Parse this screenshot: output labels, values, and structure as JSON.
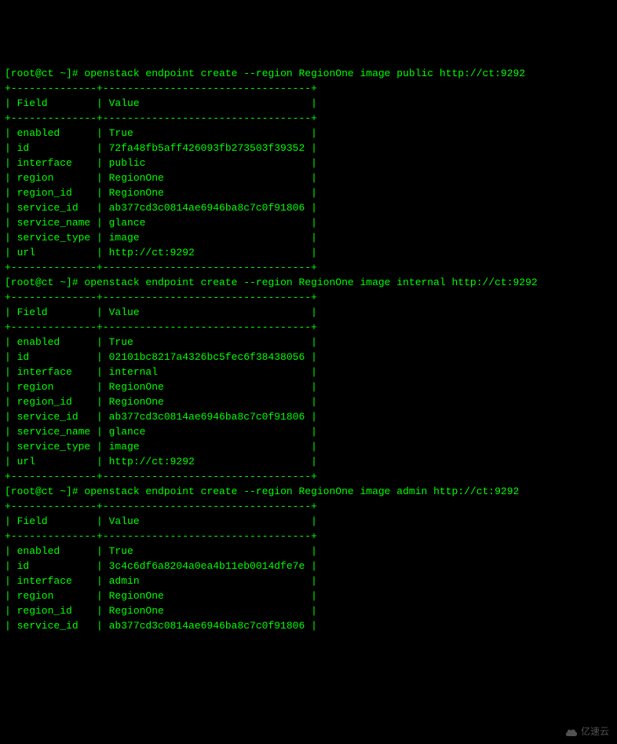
{
  "prompt": {
    "userhost": "[root@ct ~]#",
    "cmd1": "openstack endpoint create --region RegionOne image public http://ct:9292",
    "cmd2": "openstack endpoint create --region RegionOne image internal http://ct:9292",
    "cmd3": "openstack endpoint create --region RegionOne image admin http://ct:9292"
  },
  "borders": {
    "sep": "+--------------+----------------------------------+"
  },
  "header": {
    "field": "Field",
    "value": "Value"
  },
  "table1": {
    "rows": [
      {
        "field": "enabled",
        "value": "True"
      },
      {
        "field": "id",
        "value": "72fa48fb5aff426093fb273503f39352"
      },
      {
        "field": "interface",
        "value": "public"
      },
      {
        "field": "region",
        "value": "RegionOne"
      },
      {
        "field": "region_id",
        "value": "RegionOne"
      },
      {
        "field": "service_id",
        "value": "ab377cd3c0814ae6946ba8c7c0f91806"
      },
      {
        "field": "service_name",
        "value": "glance"
      },
      {
        "field": "service_type",
        "value": "image"
      },
      {
        "field": "url",
        "value": "http://ct:9292"
      }
    ]
  },
  "table2": {
    "rows": [
      {
        "field": "enabled",
        "value": "True"
      },
      {
        "field": "id",
        "value": "02101bc8217a4326bc5fec6f38438056"
      },
      {
        "field": "interface",
        "value": "internal"
      },
      {
        "field": "region",
        "value": "RegionOne"
      },
      {
        "field": "region_id",
        "value": "RegionOne"
      },
      {
        "field": "service_id",
        "value": "ab377cd3c0814ae6946ba8c7c0f91806"
      },
      {
        "field": "service_name",
        "value": "glance"
      },
      {
        "field": "service_type",
        "value": "image"
      },
      {
        "field": "url",
        "value": "http://ct:9292"
      }
    ]
  },
  "table3": {
    "rows": [
      {
        "field": "enabled",
        "value": "True"
      },
      {
        "field": "id",
        "value": "3c4c6df6a8204a0ea4b11eb0014dfe7e"
      },
      {
        "field": "interface",
        "value": "admin"
      },
      {
        "field": "region",
        "value": "RegionOne"
      },
      {
        "field": "region_id",
        "value": "RegionOne"
      },
      {
        "field": "service_id",
        "value": "ab377cd3c0814ae6946ba8c7c0f91806"
      }
    ]
  },
  "watermark": {
    "text": "亿速云"
  }
}
